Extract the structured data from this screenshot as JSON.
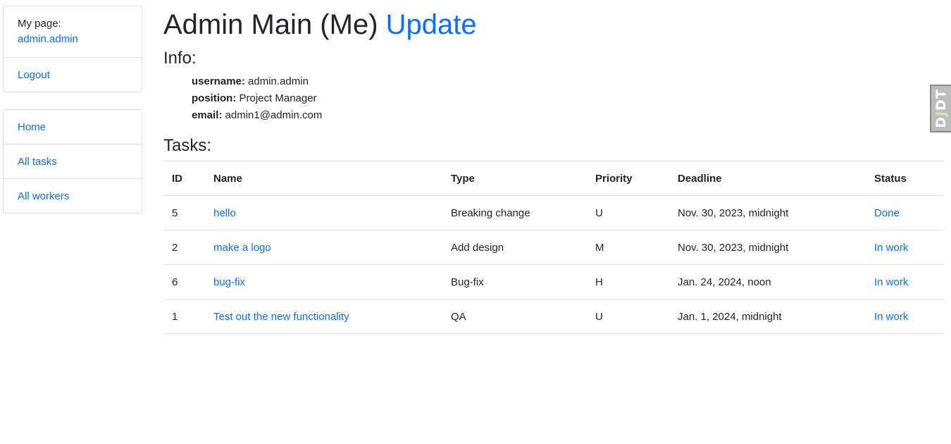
{
  "sidebar": {
    "my_page_label": "My page:",
    "my_page_user": "admin.admin",
    "logout": "Logout",
    "nav": [
      "Home",
      "All tasks",
      "All workers"
    ]
  },
  "header": {
    "title": "Admin Main (Me)",
    "update_link": "Update"
  },
  "info": {
    "heading": "Info:",
    "username_label": "username:",
    "username": "admin.admin",
    "position_label": "position:",
    "position": "Project Manager",
    "email_label": "email:",
    "email": "admin1@admin.com"
  },
  "tasks": {
    "heading": "Tasks:",
    "columns": [
      "ID",
      "Name",
      "Type",
      "Priority",
      "Deadline",
      "Status"
    ],
    "rows": [
      {
        "id": "5",
        "name": "hello",
        "type": "Breaking change",
        "priority": "U",
        "deadline": "Nov. 30, 2023, midnight",
        "status": "Done"
      },
      {
        "id": "2",
        "name": "make a logo",
        "type": "Add design",
        "priority": "M",
        "deadline": "Nov. 30, 2023, midnight",
        "status": "In work"
      },
      {
        "id": "6",
        "name": "bug-fix",
        "type": "Bug-fix",
        "priority": "H",
        "deadline": "Jan. 24, 2024, noon",
        "status": "In work"
      },
      {
        "id": "1",
        "name": "Test out the new functionality",
        "type": "QA",
        "priority": "U",
        "deadline": "Jan. 1, 2024, midnight",
        "status": "In work"
      }
    ]
  },
  "toolbar": {
    "handle_prefix": "D",
    "handle_j": "J",
    "handle_suffix": "DT"
  },
  "colors": {
    "link": "#0d6efd",
    "text": "#212529",
    "border": "#dfdfdf"
  }
}
